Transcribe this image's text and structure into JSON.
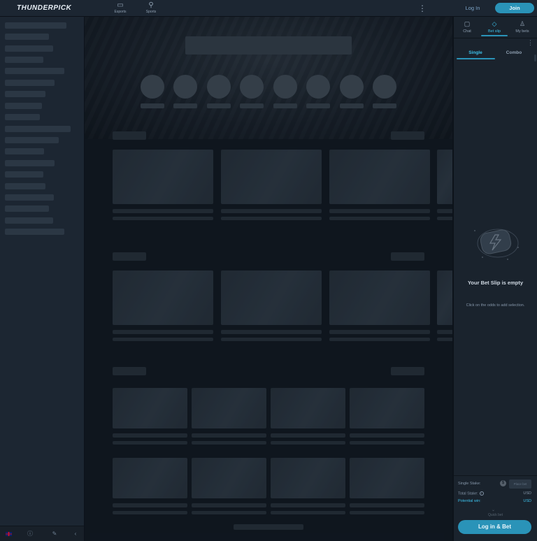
{
  "header": {
    "logo_text": "THUNDERPICK",
    "nav": [
      {
        "label": "Esports",
        "icon": "esports-icon"
      },
      {
        "label": "Sports",
        "icon": "sports-icon"
      }
    ],
    "login_label": "Log In",
    "join_label": "Join"
  },
  "sidebar": {
    "footer_icons": [
      "uk-flag-icon",
      "help-icon",
      "edit-icon",
      "collapse-icon"
    ]
  },
  "betslip": {
    "tabs": [
      {
        "label": "Chat",
        "icon": "chat-icon"
      },
      {
        "label": "Bet slip",
        "icon": "ticket-icon"
      },
      {
        "label": "My bets",
        "icon": "my-bets-icon"
      }
    ],
    "active_tab": "Bet slip",
    "subtabs": [
      "Single",
      "Combo"
    ],
    "active_subtab": "Single",
    "empty_title": "Your Bet Slip is empty",
    "empty_hint": "Click on the odds to add selection.",
    "single_stake_label": "Single Stake:",
    "stake_symbol": "$",
    "stake_placeholder": "Place bet",
    "total_stake_label": "Total Stake:",
    "total_stake_value": "USD",
    "potential_win_label": "Potential win:",
    "potential_win_value": "USD",
    "quick_label": "Quick bet",
    "login_bet_label": "Log in & Bet"
  },
  "colors": {
    "accent": "#2a93b8",
    "accent_text": "#3cc0ea",
    "panel": "#1a232d",
    "background": "#131b25"
  }
}
